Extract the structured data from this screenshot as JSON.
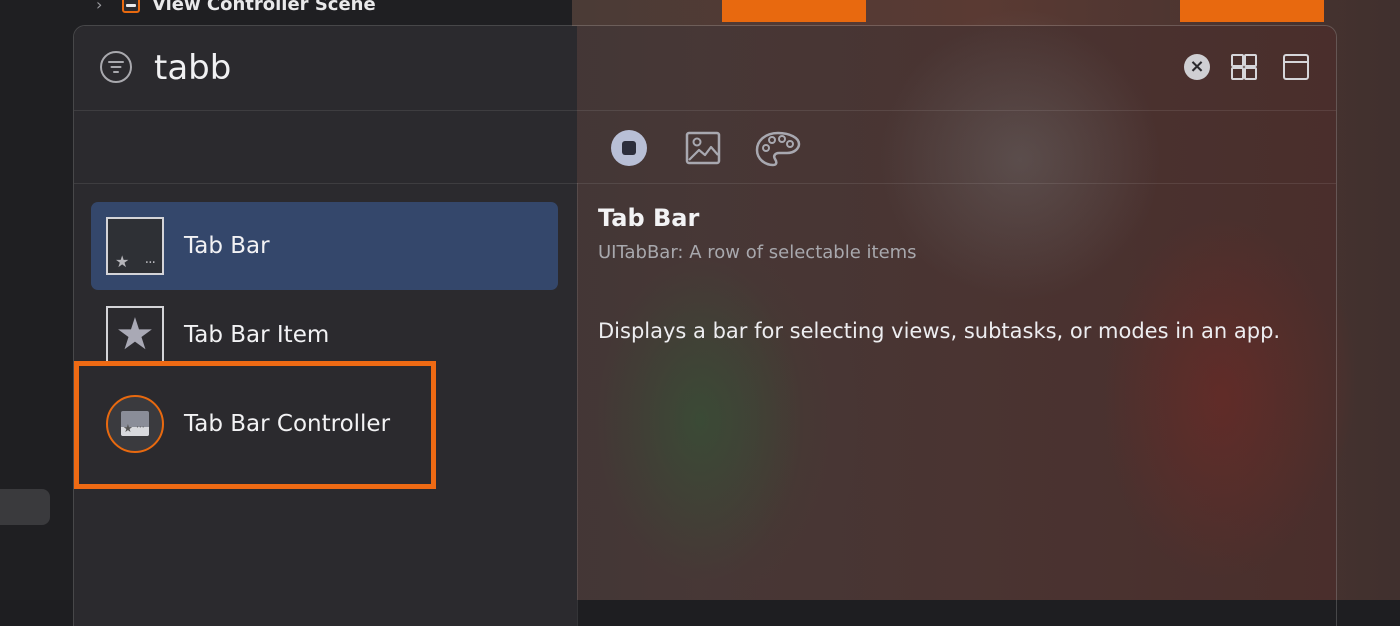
{
  "background": {
    "scene_row": {
      "label": "View Controller Scene"
    },
    "accent_color": "#e8690f"
  },
  "library": {
    "search": {
      "value": "tabb",
      "clear_label": "×"
    },
    "categories": [
      {
        "name": "objects",
        "icon": "objects-icon",
        "selected": true
      },
      {
        "name": "media",
        "icon": "image-icon",
        "selected": false
      },
      {
        "name": "colors",
        "icon": "palette-icon",
        "selected": false
      }
    ],
    "results": [
      {
        "label": "Tab Bar",
        "icon": "tab-bar-icon",
        "selected": true
      },
      {
        "label": "Tab Bar Item",
        "icon": "star-icon",
        "selected": false
      },
      {
        "label": "Tab Bar Controller",
        "icon": "tab-bar-controller-icon",
        "selected": false,
        "highlighted": true
      }
    ],
    "detail": {
      "title": "Tab Bar",
      "subtitle": "UITabBar: A row of selectable items",
      "description": "Displays a bar for selecting views, subtasks, or modes in an app."
    }
  }
}
